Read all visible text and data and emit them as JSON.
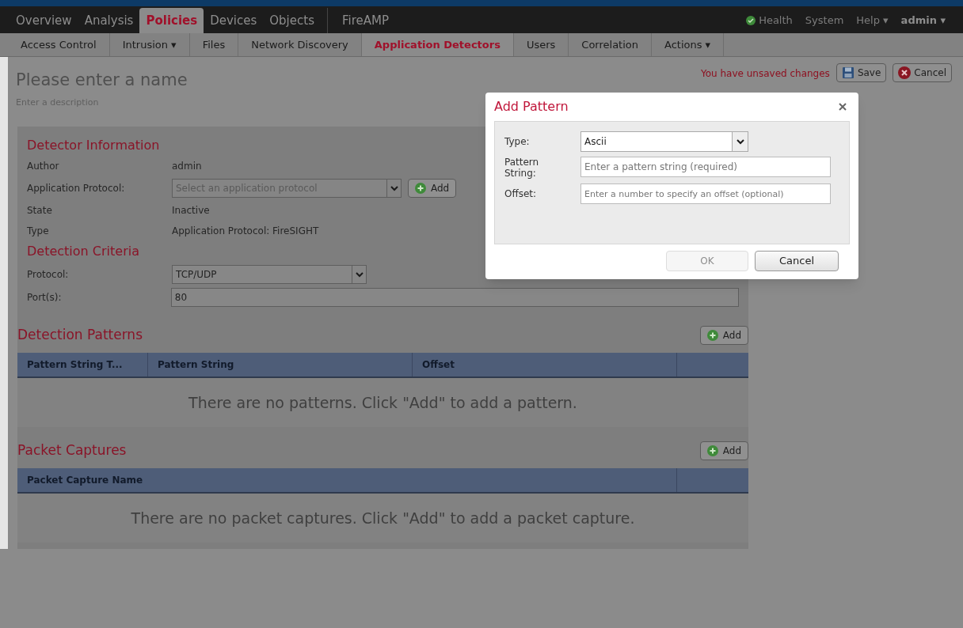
{
  "top_nav": {
    "items": [
      {
        "label": "Overview",
        "selected": false
      },
      {
        "label": "Analysis",
        "selected": false
      },
      {
        "label": "Policies",
        "selected": true
      },
      {
        "label": "Devices",
        "selected": false
      },
      {
        "label": "Objects",
        "selected": false
      },
      {
        "label": "FireAMP",
        "selected": false
      }
    ],
    "right_items": [
      {
        "label": "Health",
        "kind": "status"
      },
      {
        "label": "System",
        "kind": "link"
      },
      {
        "label": "Help ▾",
        "kind": "link"
      },
      {
        "label": "admin ▾",
        "kind": "user"
      }
    ]
  },
  "sub_nav": {
    "items": [
      {
        "label": "Access Control",
        "selected": false
      },
      {
        "label": "Intrusion ▾",
        "selected": false
      },
      {
        "label": "Files",
        "selected": false
      },
      {
        "label": "Network Discovery",
        "selected": false
      },
      {
        "label": "Application Detectors",
        "selected": true
      },
      {
        "label": "Users",
        "selected": false
      },
      {
        "label": "Correlation",
        "selected": false
      },
      {
        "label": "Actions ▾",
        "selected": false
      }
    ]
  },
  "header": {
    "name_placeholder": "Please enter a name",
    "description_placeholder": "Enter a description",
    "unsaved_message": "You have unsaved changes",
    "save_label": "Save",
    "cancel_label": "Cancel"
  },
  "detector_information": {
    "title": "Detector Information",
    "author_label": "Author",
    "author": "admin",
    "protocol_label": "Application Protocol:",
    "protocol_placeholder": "Select an application protocol",
    "add_label": "Add",
    "state_label": "State",
    "state": "Inactive",
    "type_label": "Type",
    "type": "Application Protocol: FireSIGHT"
  },
  "detection_criteria": {
    "title": "Detection Criteria",
    "protocol_label": "Protocol:",
    "protocol": "TCP/UDP",
    "ports_label": "Port(s):",
    "ports": "80"
  },
  "detection_patterns": {
    "title": "Detection Patterns",
    "add_label": "Add",
    "columns": [
      "Pattern String T...",
      "Pattern String",
      "Offset"
    ],
    "empty_message": "There are no patterns. Click \"Add\" to add a pattern."
  },
  "packet_captures": {
    "title": "Packet Captures",
    "add_label": "Add",
    "columns": [
      "Packet Capture Name"
    ],
    "empty_message": "There are no packet captures. Click \"Add\" to add a packet capture."
  },
  "dialog": {
    "title": "Add Pattern",
    "type_label": "Type:",
    "type": "Ascii",
    "pattern_label": "Pattern String:",
    "pattern_placeholder": "Enter a pattern string (required)",
    "offset_label": "Offset:",
    "offset_placeholder": "Enter a number to specify an offset (optional)",
    "ok_label": "OK",
    "ok_disabled": true,
    "cancel_label": "Cancel"
  }
}
